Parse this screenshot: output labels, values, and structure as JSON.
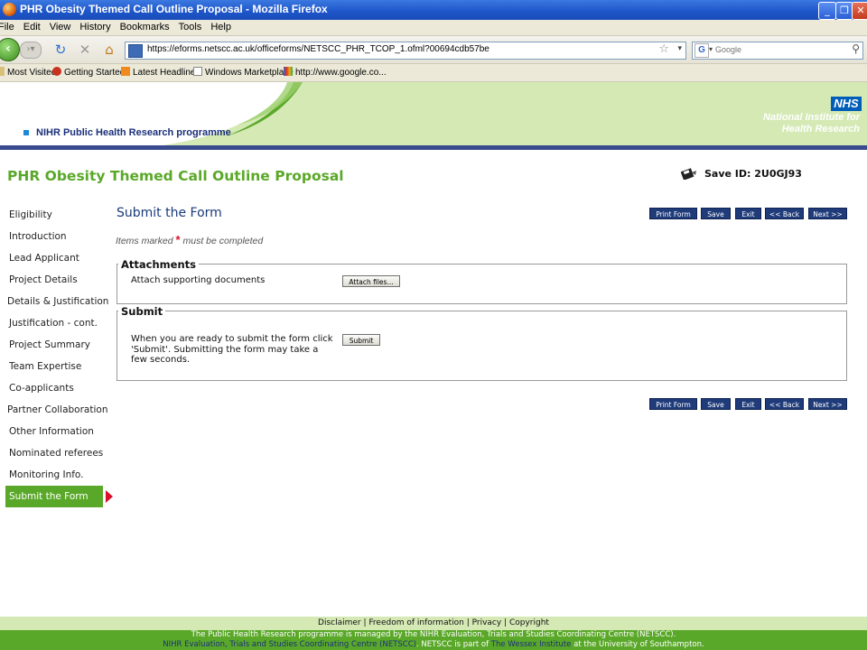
{
  "window": {
    "title": "PHR Obesity Themed Call Outline Proposal - Mozilla Firefox",
    "minimize": "_",
    "maximize": "❐",
    "close": "✕"
  },
  "menu": [
    "File",
    "Edit",
    "View",
    "History",
    "Bookmarks",
    "Tools",
    "Help"
  ],
  "nav": {
    "url": "https://eforms.netscc.ac.uk/officeforms/NETSCC_PHR_TCOP_1.ofml?00694cdb57be",
    "search_placeholder": "Google"
  },
  "bookmarks": [
    "Most Visited",
    "Getting Started",
    "Latest Headlines",
    "Windows Marketplace",
    "http://www.google.co..."
  ],
  "header": {
    "programme": "NIHR Public Health Research programme",
    "nhs": "NHS",
    "institute_line1": "National Institute for",
    "institute_line2": "Health Research"
  },
  "page": {
    "form_title": "PHR Obesity Themed Call Outline Proposal",
    "save_id": "Save ID: 2U0GJ93",
    "section_title": "Submit the Form",
    "required_pre": "Items marked",
    "required_star": "*",
    "required_post": "must be completed"
  },
  "sidebar": {
    "items": [
      {
        "label": "Eligibility"
      },
      {
        "label": "Introduction"
      },
      {
        "label": "Lead Applicant"
      },
      {
        "label": "Project Details"
      },
      {
        "label": "Details & Justification"
      },
      {
        "label": "Justification - cont."
      },
      {
        "label": "Project Summary"
      },
      {
        "label": "Team Expertise"
      },
      {
        "label": "Co-applicants"
      },
      {
        "label": "Partner Collaboration"
      },
      {
        "label": "Other Information"
      },
      {
        "label": "Nominated referees"
      },
      {
        "label": "Monitoring Info."
      },
      {
        "label": "Submit the Form",
        "active": true
      }
    ]
  },
  "toolbar": {
    "print": "Print Form",
    "save": "Save",
    "exit": "Exit",
    "back": "<< Back",
    "next": "Next >>"
  },
  "attachments": {
    "legend": "Attachments",
    "label": "Attach supporting documents",
    "button": "Attach files..."
  },
  "submit": {
    "legend": "Submit",
    "text": "When you are ready to submit the form click 'Submit'. Submitting the form may take a few seconds.",
    "button": "Submit"
  },
  "footer": {
    "links": [
      "Disclaimer",
      "Freedom of information",
      "Privacy",
      "Copyright"
    ],
    "line1": "The Public Health Research programme is managed by the NIHR Evaluation, Trials and Studies Coordinating Centre (NETSCC).",
    "line2_link1": "NIHR Evaluation, Trials and Studies Coordinating Centre (NETSCC)",
    "line2_mid": ". NETSCC is part of",
    "line2_link2": "The Wessex Institute",
    "line2_end": "at the University of Southampton."
  }
}
